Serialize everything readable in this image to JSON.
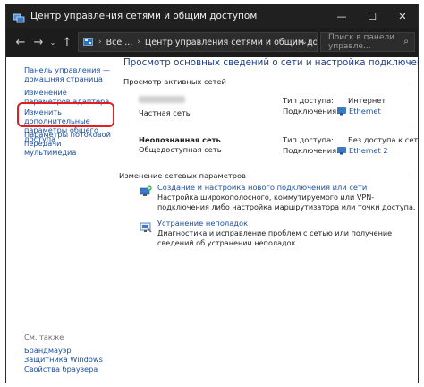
{
  "window": {
    "title": "Центр управления сетями и общим доступом",
    "controls": {
      "minimize": "—",
      "maximize": "☐",
      "close": "✕"
    }
  },
  "address": {
    "back": "←",
    "forward": "→",
    "recent": "⌄",
    "up": "↑",
    "crumbs": [
      "Все ...",
      "Центр управления сетями и общим доступом"
    ],
    "separator": "›",
    "dropdown": "⌄",
    "refresh": "↻",
    "search_placeholder": "Поиск в панели управле...",
    "search_icon": "⌕"
  },
  "sidebar": {
    "links": [
      "Панель управления — домашняя страница",
      "Изменение параметров адаптера",
      "Изменить дополнительные параметры общего доступа",
      "Параметры потоковой передачи мультимедиа"
    ],
    "see_also_label": "См. также",
    "see_also": [
      "Брандмауэр Защитника Windows",
      "Свойства браузера"
    ]
  },
  "main": {
    "heading": "Просмотр основных сведений о сети и настройка подключений",
    "active_networks_title": "Просмотр активных сетей",
    "networks": [
      {
        "name": "",
        "type": "Частная сеть",
        "access_label": "Тип доступа:",
        "access_value": "Интернет",
        "connections_label": "Подключения:",
        "connection": "Ethernet"
      },
      {
        "name": "Неопознанная сеть",
        "type": "Общедоступная сеть",
        "access_label": "Тип доступа:",
        "access_value": "Без доступа к сети",
        "connections_label": "Подключения:",
        "connection": "Ethernet 2"
      }
    ],
    "change_settings_title": "Изменение сетевых параметров",
    "tasks": [
      {
        "link": "Создание и настройка нового подключения или сети",
        "desc": "Настройка широкополосного, коммутируемого или VPN-подключения либо настройка маршрутизатора или точки доступа."
      },
      {
        "link": "Устранение неполадок",
        "desc": "Диагностика и исправление проблем с сетью или получение сведений об устранении неполадок."
      }
    ]
  },
  "icons": {
    "app": "network-center-icon",
    "ethernet": "ethernet-icon",
    "new_connection": "new-connection-icon",
    "troubleshoot": "troubleshoot-icon"
  },
  "colors": {
    "link": "#1a4e9d",
    "heading": "#1c3e84",
    "highlight": "#e02020",
    "titlebar": "#202020"
  }
}
